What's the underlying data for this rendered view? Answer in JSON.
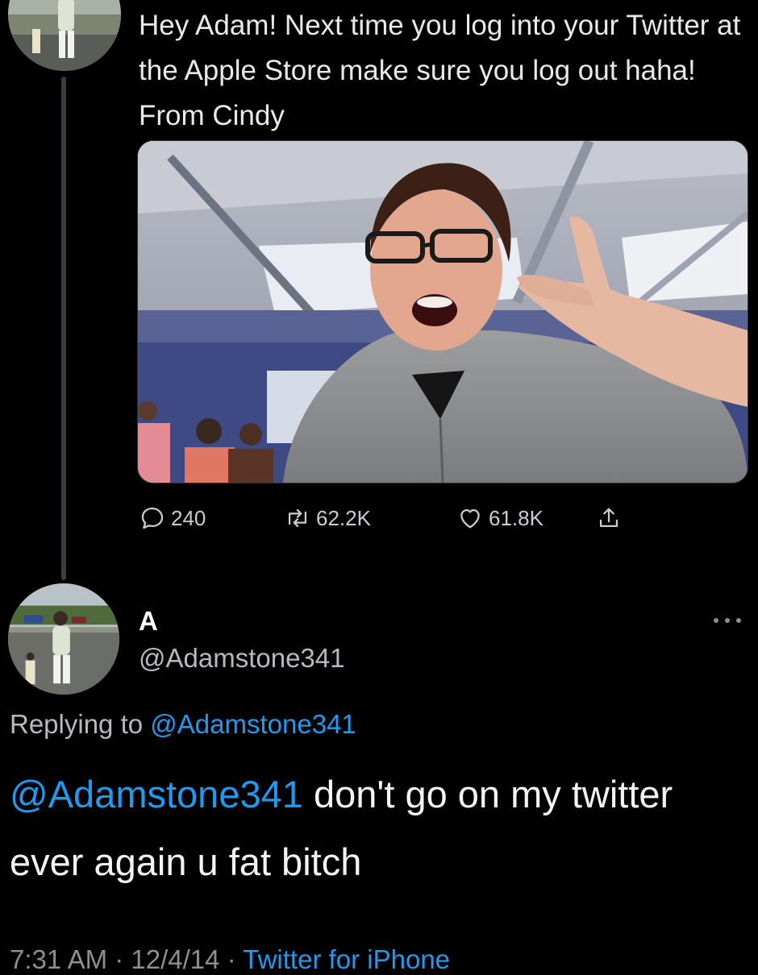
{
  "top_tweet": {
    "text": "Hey Adam! Next time you log into your Twitter at the Apple Store make sure you log out haha! From Cindy",
    "stats": {
      "replies": "240",
      "retweets": "62.2K",
      "likes": "61.8K"
    }
  },
  "main_tweet": {
    "display_name": "A",
    "handle": "@Adamstone341",
    "replying_prefix": "Replying to",
    "replying_to": "@Adamstone341",
    "mention": "@Adamstone341",
    "body": " don't go on my twitter ever again u fat bitch",
    "time": "7:31 AM",
    "date": "12/4/14",
    "separator": " · ",
    "source": "Twitter for iPhone"
  },
  "icons": {
    "reply": "speech-bubble-icon",
    "retweet": "retweet-arrows-icon",
    "like": "heart-icon",
    "share": "share-upload-icon",
    "more": "ellipsis-icon"
  },
  "colors": {
    "background": "#000000",
    "link": "#1d9bf0",
    "text": "#e7e9ea",
    "secondary": "#b6babf"
  }
}
